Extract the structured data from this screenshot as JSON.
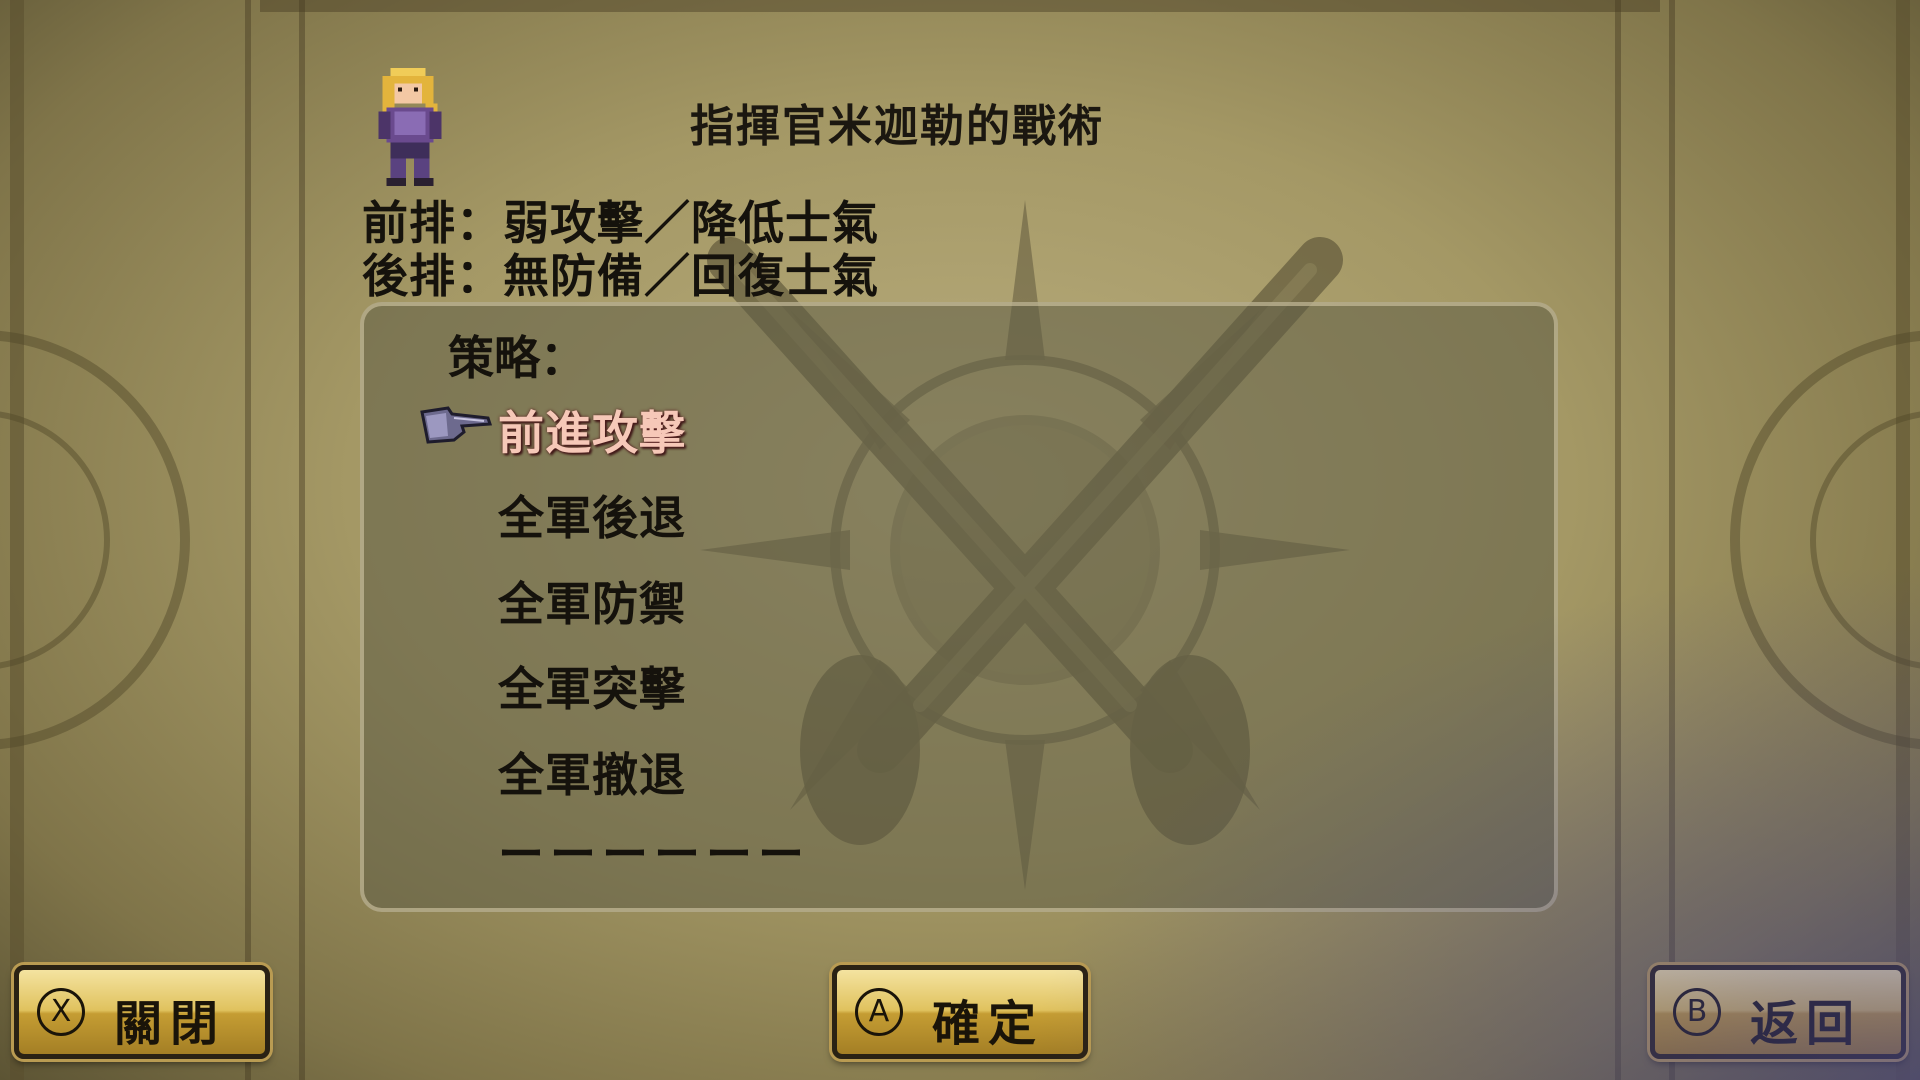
{
  "title": "指揮官米迦勒的戰術",
  "formation_effects": {
    "front": "前排：弱攻擊／降低士氣",
    "back": "後排：無防備／回復士氣"
  },
  "strategy_panel": {
    "label": "策略：",
    "selected_index": 0,
    "options": [
      "前進攻擊",
      "全軍後退",
      "全軍防禦",
      "全軍突擊",
      "全軍撤退",
      "ーーーーーー"
    ]
  },
  "buttons": {
    "close": {
      "key": "X",
      "label": "關閉"
    },
    "confirm": {
      "key": "A",
      "label": "確定"
    },
    "back": {
      "key": "B",
      "label": "返回"
    }
  },
  "icons": {
    "portrait": "commander-portrait-icon",
    "cursor": "pointing-gauntlet-icon",
    "emblem": "crossed-swords-emblem"
  },
  "colors": {
    "selected_text": "#f6c8b8",
    "text": "#15120c",
    "button_gold": "#e0c25e"
  }
}
